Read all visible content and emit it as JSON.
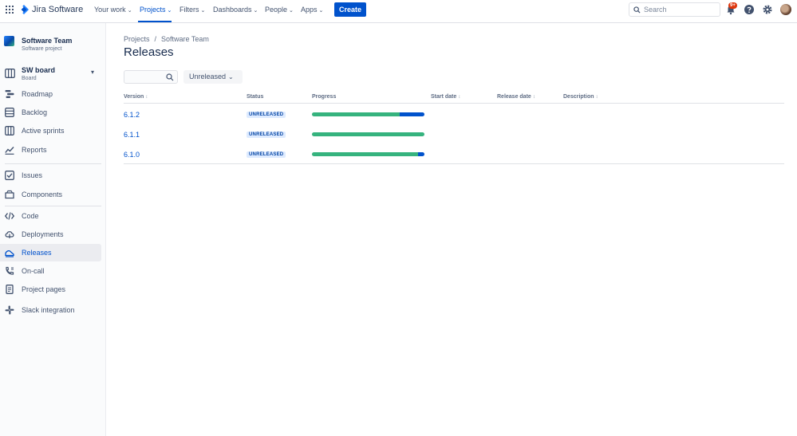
{
  "topnav": {
    "app_name": "Jira Software",
    "items": [
      {
        "label": "Your work"
      },
      {
        "label": "Projects"
      },
      {
        "label": "Filters"
      },
      {
        "label": "Dashboards"
      },
      {
        "label": "People"
      },
      {
        "label": "Apps"
      }
    ],
    "active_item": "Projects",
    "create_label": "Create",
    "search_placeholder": "Search",
    "notification_badge": "9+",
    "icons": [
      "app-switcher-icon",
      "jira-logo-icon",
      "search-icon",
      "bell-icon",
      "help-icon",
      "settings-icon",
      "avatar"
    ]
  },
  "sidebar": {
    "project_title": "Software Team",
    "project_sub": "Software project",
    "board_title": "SW board",
    "board_sub": "Board",
    "items": [
      {
        "label": "Roadmap",
        "icon": "roadmap-icon"
      },
      {
        "label": "Backlog",
        "icon": "backlog-icon"
      },
      {
        "label": "Active sprints",
        "icon": "board-icon"
      },
      {
        "label": "Reports",
        "icon": "reports-icon"
      },
      {
        "label": "Issues",
        "icon": "issues-icon"
      },
      {
        "label": "Components",
        "icon": "components-icon"
      },
      {
        "label": "Code",
        "icon": "code-icon"
      },
      {
        "label": "Deployments",
        "icon": "deployments-icon"
      },
      {
        "label": "Releases",
        "icon": "releases-icon"
      },
      {
        "label": "On-call",
        "icon": "on-call-icon"
      },
      {
        "label": "Project pages",
        "icon": "pages-icon"
      },
      {
        "label": "Slack integration",
        "icon": "slack-icon"
      }
    ],
    "active_item": "Releases"
  },
  "main": {
    "breadcrumb": [
      "Projects",
      "Software Team"
    ],
    "title": "Releases",
    "filter_dropdown": "Unreleased",
    "columns": [
      "Version",
      "Status",
      "Progress",
      "Start date",
      "Release date",
      "Description"
    ],
    "rows": [
      {
        "version": "6.1.2",
        "status": "UNRELEASED",
        "progress_done": 0.78,
        "progress_inprogress": 0.22
      },
      {
        "version": "6.1.1",
        "status": "UNRELEASED",
        "progress_done": 1.0,
        "progress_inprogress": 0.0
      },
      {
        "version": "6.1.0",
        "status": "UNRELEASED",
        "progress_done": 0.94,
        "progress_inprogress": 0.06
      }
    ]
  },
  "colors": {
    "brand": "#0052cc",
    "done": "#36b37e",
    "in_progress": "#0052cc",
    "badge": "#de350b",
    "lozenge_bg": "#deebff"
  }
}
